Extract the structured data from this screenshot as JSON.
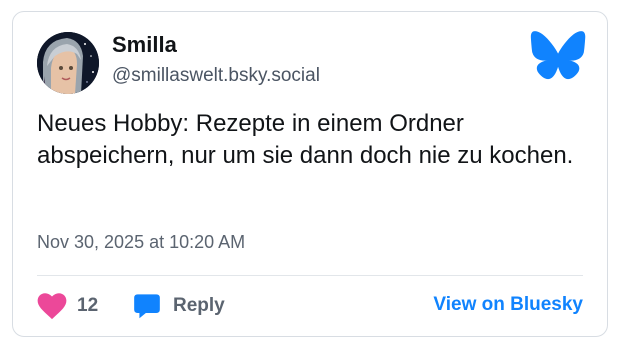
{
  "author": {
    "name": "Smilla",
    "handle": "@smillaswelt.bsky.social"
  },
  "post": {
    "text": "Neues Hobby: Rezepte in einem Ordner abspeichern, nur um sie dann doch nie zu kochen.",
    "timestamp": "Nov 30, 2025 at 10:20 AM"
  },
  "actions": {
    "like_count": "12",
    "reply_label": "Reply",
    "view_link": "View on Bluesky"
  },
  "icons": {
    "logo": "bluesky-butterfly-icon",
    "like": "heart-icon",
    "reply": "speech-bubble-icon"
  },
  "colors": {
    "brand": "#1083fe",
    "like": "#ec4899",
    "text": "#111417",
    "muted": "#5b6470"
  }
}
